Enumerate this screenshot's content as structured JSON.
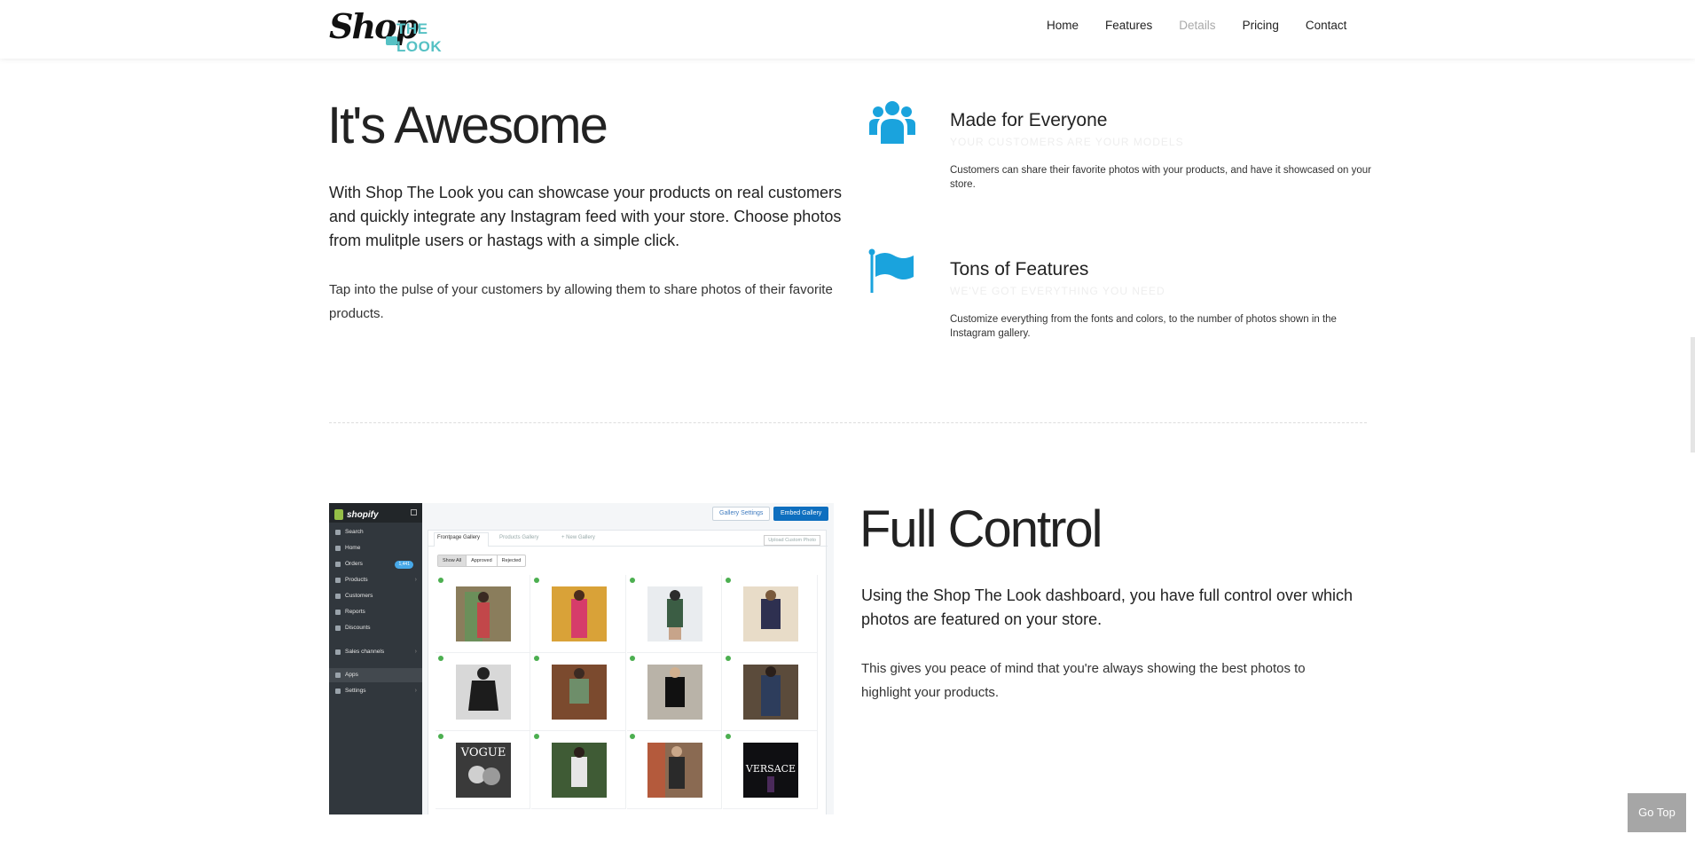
{
  "brand": {
    "logo_main": "Shop",
    "logo_sub": "THE LOOK"
  },
  "nav": {
    "items": [
      {
        "label": "Home"
      },
      {
        "label": "Features"
      },
      {
        "label": "Details"
      },
      {
        "label": "Pricing"
      },
      {
        "label": "Contact"
      }
    ]
  },
  "section1": {
    "title": "It's Awesome",
    "lead": "With Shop The Look you can showcase your products on real customers and quickly integrate any Instagram feed with your store. Choose photos from mulitple users or hastags with a simple click.",
    "sub": "Tap into the pulse of your customers by allowing them to share photos of their favorite products.",
    "features": [
      {
        "icon": "users-icon",
        "title": "Made for Everyone",
        "tagline": "Your customers are your models",
        "text": "Customers can share their favorite photos with your products, and have it showcased on your store."
      },
      {
        "icon": "flag-icon",
        "title": "Tons of Features",
        "tagline": "We've got everything you need",
        "text": "Customize everything from the fonts and colors, to the number of photos shown in the Instagram gallery."
      }
    ]
  },
  "section2": {
    "title": "Full Control",
    "lead": "Using the Shop The Look dashboard, you have full control over which photos are featured on your store.",
    "sub": "This gives you peace of mind that you're always showing the best photos to highlight your products."
  },
  "dashboard": {
    "brand": "shopify",
    "sidebar": [
      {
        "label": "Search"
      },
      {
        "label": "Home"
      },
      {
        "label": "Orders",
        "badge": "1,441"
      },
      {
        "label": "Products"
      },
      {
        "label": "Customers"
      },
      {
        "label": "Reports"
      },
      {
        "label": "Discounts"
      },
      {
        "label": "Sales channels"
      },
      {
        "label": "Apps"
      },
      {
        "label": "Settings"
      }
    ],
    "buttons": {
      "gallery_settings": "Gallery Settings",
      "embed_gallery": "Embed Gallery"
    },
    "tabs": {
      "frontpage": "Frontpage Gallery",
      "products": "Products Gallery",
      "new": "+ New Gallery"
    },
    "upload": "Upload Custom Photo",
    "filters": {
      "show_all": "Show All",
      "approved": "Approved",
      "rejected": "Rejected"
    },
    "photo_texts": {
      "vogue": "VOGUE",
      "versace": "VERSACE"
    }
  },
  "colors": {
    "accent": "#1aa3dd",
    "logo_teal": "#56c1c4",
    "shopify_sidebar": "#31373d",
    "primary_button": "#0e6fbf"
  },
  "gotop": "Go Top"
}
